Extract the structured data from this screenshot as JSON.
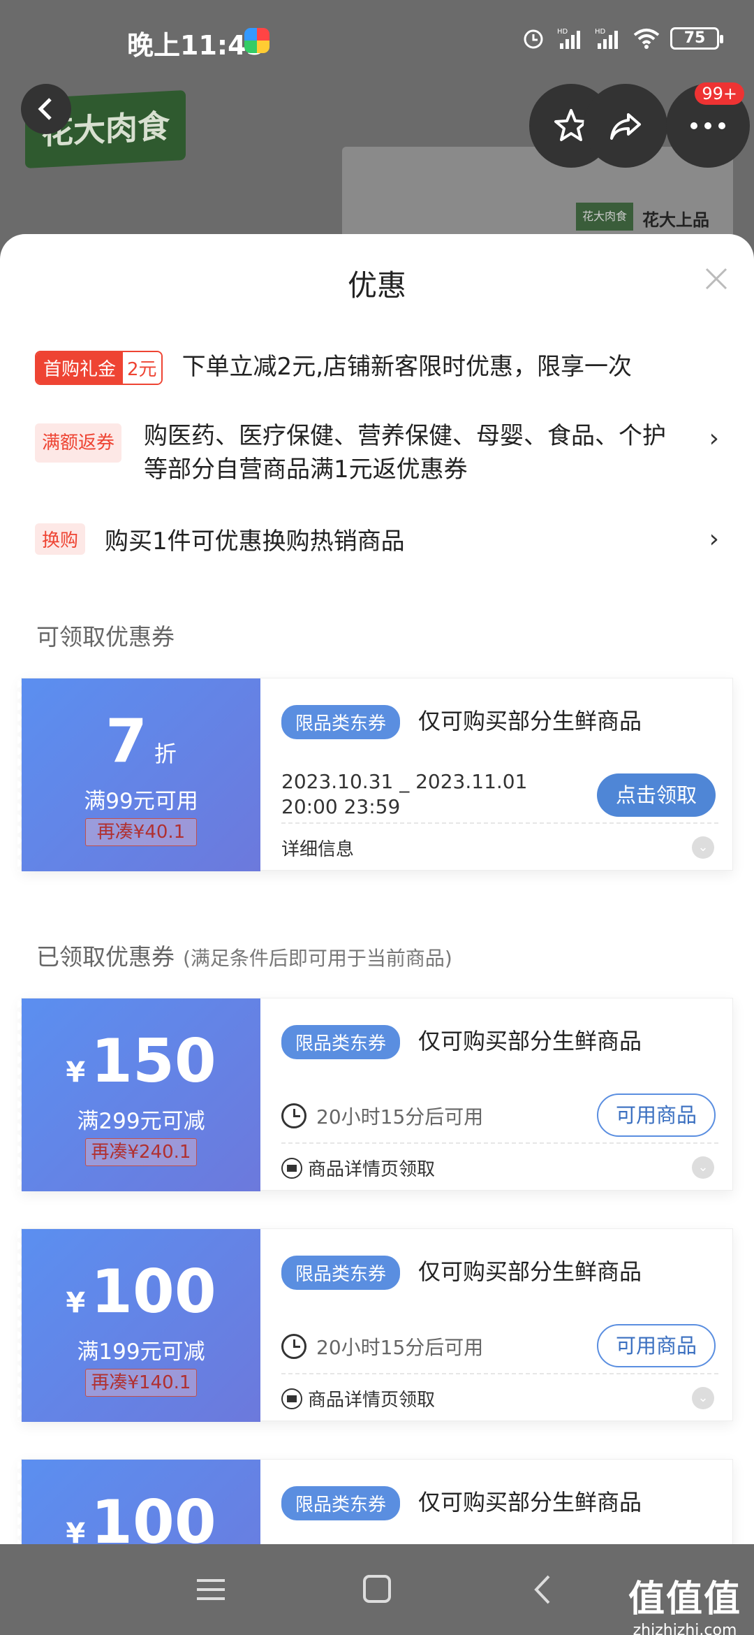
{
  "status_bar": {
    "time": "晚上11:45",
    "battery": "75"
  },
  "background": {
    "brand_logo": "花大肉食",
    "product_logo": "花大肉食",
    "product_text": "花大上品",
    "more_badge": "99+"
  },
  "sheet": {
    "title": "优惠",
    "promos": [
      {
        "tag_a": "首购礼金",
        "tag_b": "2元",
        "text": "下单立减2元,店铺新客限时优惠，限享一次"
      },
      {
        "tag": "满额返券",
        "text": "购医药、医疗保健、营养保健、母婴、食品、个护等部分自营商品满1元返优惠券"
      },
      {
        "tag": "换购",
        "text": "购买1件可优惠换购热销商品"
      }
    ],
    "available_section": "可领取优惠券",
    "claimed_section": "已领取优惠券",
    "claimed_note": "(满足条件后即可用于当前商品)",
    "coupons": [
      {
        "amount": "7",
        "unit": "折",
        "condition": "满99元可用",
        "more": "再凑¥40.1",
        "category_tag": "限品类东券",
        "title": "仅可购买部分生鲜商品",
        "date_line1": "2023.10.31 _ 2023.11.01",
        "date_line2": "20:00 23:59",
        "button": "点击领取",
        "detail": "详细信息"
      },
      {
        "yen": "¥",
        "amount": "150",
        "condition": "满299元可减",
        "more": "再凑¥240.1",
        "category_tag": "限品类东券",
        "title": "仅可购买部分生鲜商品",
        "wait": "20小时15分后可用",
        "button": "可用商品",
        "detail": "商品详情页领取"
      },
      {
        "yen": "¥",
        "amount": "100",
        "condition": "满199元可减",
        "more": "再凑¥140.1",
        "category_tag": "限品类东券",
        "title": "仅可购买部分生鲜商品",
        "wait": "20小时15分后可用",
        "button": "可用商品",
        "detail": "商品详情页领取"
      },
      {
        "yen": "¥",
        "amount": "100",
        "category_tag": "限品类东券",
        "title": "仅可购买部分生鲜商品"
      }
    ]
  },
  "watermark": {
    "main": "值值值",
    "sub": "zhizhizhi.com"
  }
}
